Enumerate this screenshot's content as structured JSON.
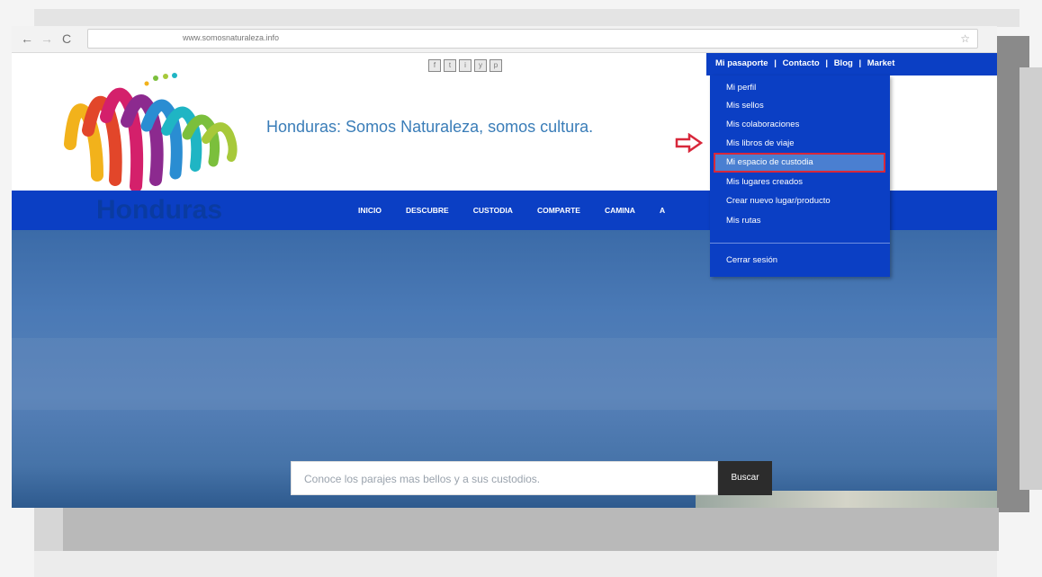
{
  "browser": {
    "url": "www.somosnaturaleza.info",
    "back_icon": "←",
    "forward_icon": "→",
    "reload_icon": "C",
    "star_icon": "☆"
  },
  "site": {
    "logo_word": "Honduras",
    "tagline": "Honduras: Somos Naturaleza, somos cultura.",
    "top_links": [
      "Mi pasaporte",
      "Contacto",
      "Blog",
      "Market"
    ],
    "top_separator": "|",
    "nav": [
      "INICIO",
      "DESCUBRE",
      "CUSTODIA",
      "COMPARTE",
      "CAMINA",
      "A"
    ],
    "dropdown": [
      "Mi perfil",
      "Mis sellos",
      "Mis colaboraciones",
      "Mis libros de viaje",
      "Mi espacio de custodia",
      "Mis lugares creados",
      "Crear nuevo lugar/producto",
      "Mis rutas"
    ],
    "dropdown_logout": "Cerrar sesión",
    "search_placeholder": "Conoce los parajes mas bellos y a sus custodios.",
    "search_button": "Buscar"
  },
  "colors": {
    "brand_blue": "#0b3fc4",
    "highlight_border": "#d8283b"
  }
}
